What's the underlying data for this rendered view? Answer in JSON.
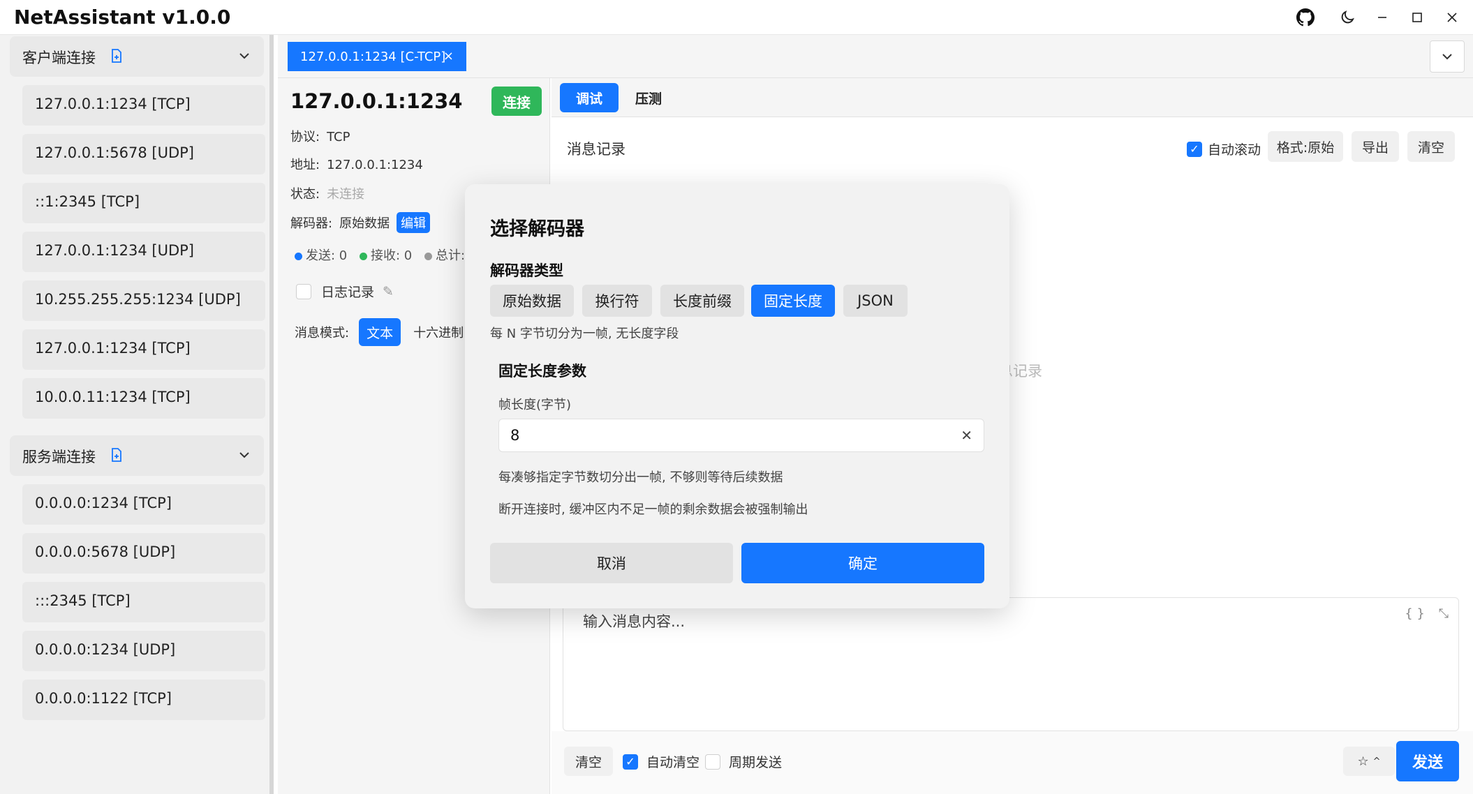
{
  "window": {
    "title": "NetAssistant v1.0.0"
  },
  "sidebar": {
    "client_section": "客户端连接",
    "client_items": [
      "127.0.0.1:1234 [TCP]",
      "127.0.0.1:5678 [UDP]",
      "::1:2345 [TCP]",
      "127.0.0.1:1234 [UDP]",
      "10.255.255.255:1234 [UDP]",
      "127.0.0.1:1234 [TCP]",
      "10.0.0.11:1234 [TCP]"
    ],
    "server_section": "服务端连接",
    "server_items": [
      "0.0.0.0:1234 [TCP]",
      "0.0.0.0:5678 [UDP]",
      ":::2345 [TCP]",
      "0.0.0.0:1234 [UDP]",
      "0.0.0.0:1122 [TCP]"
    ]
  },
  "tabs": {
    "active_tab": "127.0.0.1:1234 [C-TCP]",
    "close": "×"
  },
  "info": {
    "host": "127.0.0.1:1234",
    "connect_label": "连接",
    "protocol_label": "协议:",
    "protocol_value": "TCP",
    "address_label": "地址:",
    "address_value": "127.0.0.1:1234",
    "status_label": "状态:",
    "status_value": "未连接",
    "decoder_label": "解码器:",
    "decoder_value": "原始数据",
    "edit_label": "编辑",
    "sent": "发送: 0",
    "received": "接收: 0",
    "total": "总计: (",
    "log_label": "日志记录",
    "mode_label": "消息模式:",
    "mode_text": "文本",
    "mode_hex": "十六进制"
  },
  "main": {
    "tab_debug": "调试",
    "tab_stress": "压测",
    "messages_title": "消息记录",
    "auto_scroll": "自动滚动",
    "format": "格式:原始",
    "export": "导出",
    "clear": "清空",
    "empty_hint": "息记录",
    "input_placeholder": "输入消息内容...",
    "input_icon": "{ }",
    "bottom_clear": "清空",
    "auto_clear": "自动清空",
    "periodic_send": "周期发送",
    "send": "发送"
  },
  "modal": {
    "title": "选择解码器",
    "type_label": "解码器类型",
    "options": [
      "原始数据",
      "换行符",
      "长度前缀",
      "固定长度",
      "JSON"
    ],
    "active_index": 3,
    "desc": "每 N 字节切分为一帧, 无长度字段",
    "params_title": "固定长度参数",
    "field_label": "帧长度(字节)",
    "field_value": "8",
    "hint1": "每凑够指定字节数切分出一帧, 不够则等待后续数据",
    "hint2": "断开连接时, 缓冲区内不足一帧的剩余数据会被强制输出",
    "cancel": "取消",
    "ok": "确定"
  },
  "colors": {
    "primary": "#1677ff",
    "success": "#2fb75a",
    "sent_dot": "#1677ff",
    "recv_dot": "#2fb75a",
    "total_dot": "#999999"
  }
}
